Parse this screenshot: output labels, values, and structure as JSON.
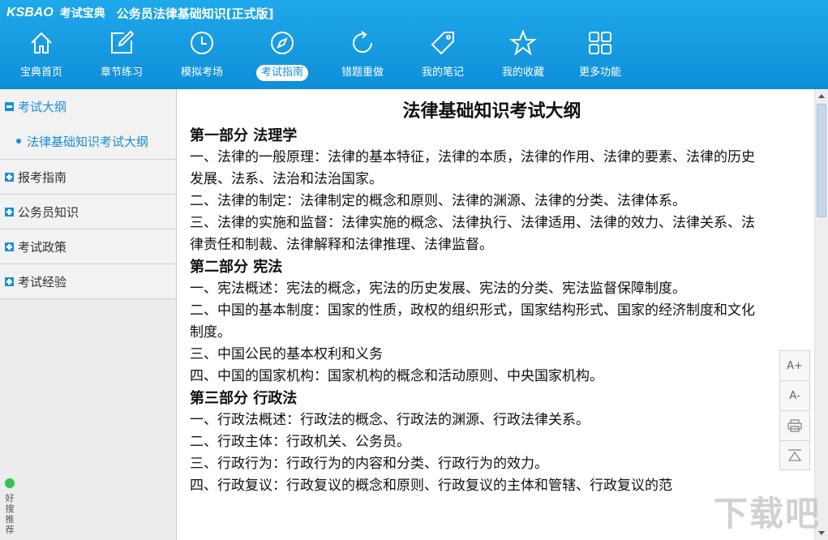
{
  "header": {
    "brand": "KSBAO",
    "brand_cn": "考试宝典",
    "app_title": "公务员法律基础知识[正式版]"
  },
  "nav": [
    {
      "label": "宝典首页",
      "icon": "home-icon"
    },
    {
      "label": "章节练习",
      "icon": "edit-icon"
    },
    {
      "label": "模拟考场",
      "icon": "clock-icon"
    },
    {
      "label": "考试指南",
      "icon": "compass-icon",
      "active": true
    },
    {
      "label": "错题重做",
      "icon": "refresh-icon"
    },
    {
      "label": "我的笔记",
      "icon": "tag-icon"
    },
    {
      "label": "我的收藏",
      "icon": "star-icon"
    },
    {
      "label": "更多功能",
      "icon": "grid-icon"
    }
  ],
  "sidebar": {
    "groups": [
      {
        "label": "考试大纲",
        "open": true,
        "children": [
          "法律基础知识考试大纲"
        ]
      },
      {
        "label": "报考指南"
      },
      {
        "label": "公务员知识"
      },
      {
        "label": "考试政策"
      },
      {
        "label": "考试经验"
      }
    ],
    "bottom_text": "好搜推荐"
  },
  "doc": {
    "title": "法律基础知识考试大纲",
    "sections": [
      {
        "title": "第一部分 法理学",
        "items": [
          "一、法律的一般原理：法律的基本特征，法律的本质，法律的作用、法律的要素、法律的历史发展、法系、法治和法治国家。",
          "二、法律的制定：法律制定的概念和原则、法律的渊源、法律的分类、法律体系。",
          "三、法律的实施和监督：法律实施的概念、法律执行、法律适用、法律的效力、法律关系、法律责任和制裁、法律解释和法律推理、法律监督。"
        ]
      },
      {
        "title": "第二部分 宪法",
        "items": [
          "一、宪法概述：宪法的概念，宪法的历史发展、宪法的分类、宪法监督保障制度。",
          "二、中国的基本制度：国家的性质，政权的组织形式，国家结构形式、国家的经济制度和文化制度。",
          "三、中国公民的基本权利和义务",
          "四、中国的国家机构：国家机构的概念和活动原则、中央国家机构。"
        ]
      },
      {
        "title": "第三部分 行政法",
        "items": [
          "一、行政法概述：行政法的概念、行政法的渊源、行政法律关系。",
          "二、行政主体：行政机关、公务员。",
          "三、行政行为：行政行为的内容和分类、行政行为的效力。",
          "四、行政复议：行政复议的概念和原则、行政复议的主体和管辖、行政复议的范"
        ]
      }
    ]
  },
  "tools": [
    "A+",
    "A-",
    "print-icon",
    "back-to-top-icon"
  ],
  "watermark": "下载吧"
}
